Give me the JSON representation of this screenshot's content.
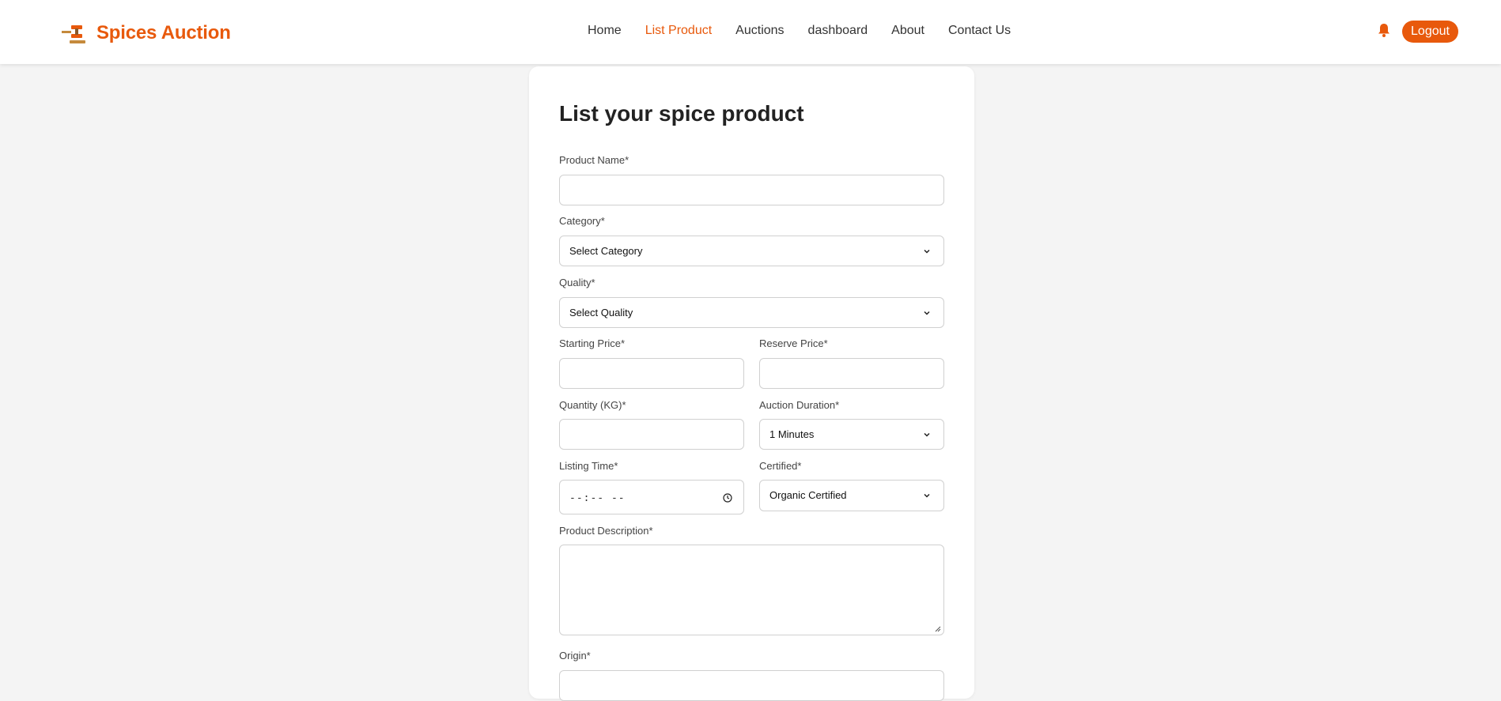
{
  "brand": {
    "name": "Spices Auction",
    "color": "#e8590c"
  },
  "nav": {
    "items": [
      {
        "label": "Home",
        "active": false
      },
      {
        "label": "List Product",
        "active": true
      },
      {
        "label": "Auctions",
        "active": false
      },
      {
        "label": "dashboard",
        "active": false
      },
      {
        "label": "About",
        "active": false
      },
      {
        "label": "Contact Us",
        "active": false
      }
    ],
    "logout_label": "Logout",
    "bell_icon": "bell-icon"
  },
  "form": {
    "title": "List your spice product",
    "product_name": {
      "label": "Product Name*",
      "value": ""
    },
    "category": {
      "label": "Category*",
      "selected": "Select Category"
    },
    "quality": {
      "label": "Quality*",
      "selected": "Select Quality"
    },
    "starting_price": {
      "label": "Starting Price*",
      "value": ""
    },
    "reserve_price": {
      "label": "Reserve Price*",
      "value": ""
    },
    "quantity": {
      "label": "Quantity (KG)*",
      "value": ""
    },
    "auction_duration": {
      "label": "Auction Duration*",
      "selected": "1 Minutes"
    },
    "listing_time": {
      "label": "Listing Time*",
      "value": "--:-- --"
    },
    "certified": {
      "label": "Certified*",
      "selected": "Organic Certified"
    },
    "description": {
      "label": "Product Description*",
      "value": ""
    },
    "origin": {
      "label": "Origin*",
      "value": ""
    }
  }
}
